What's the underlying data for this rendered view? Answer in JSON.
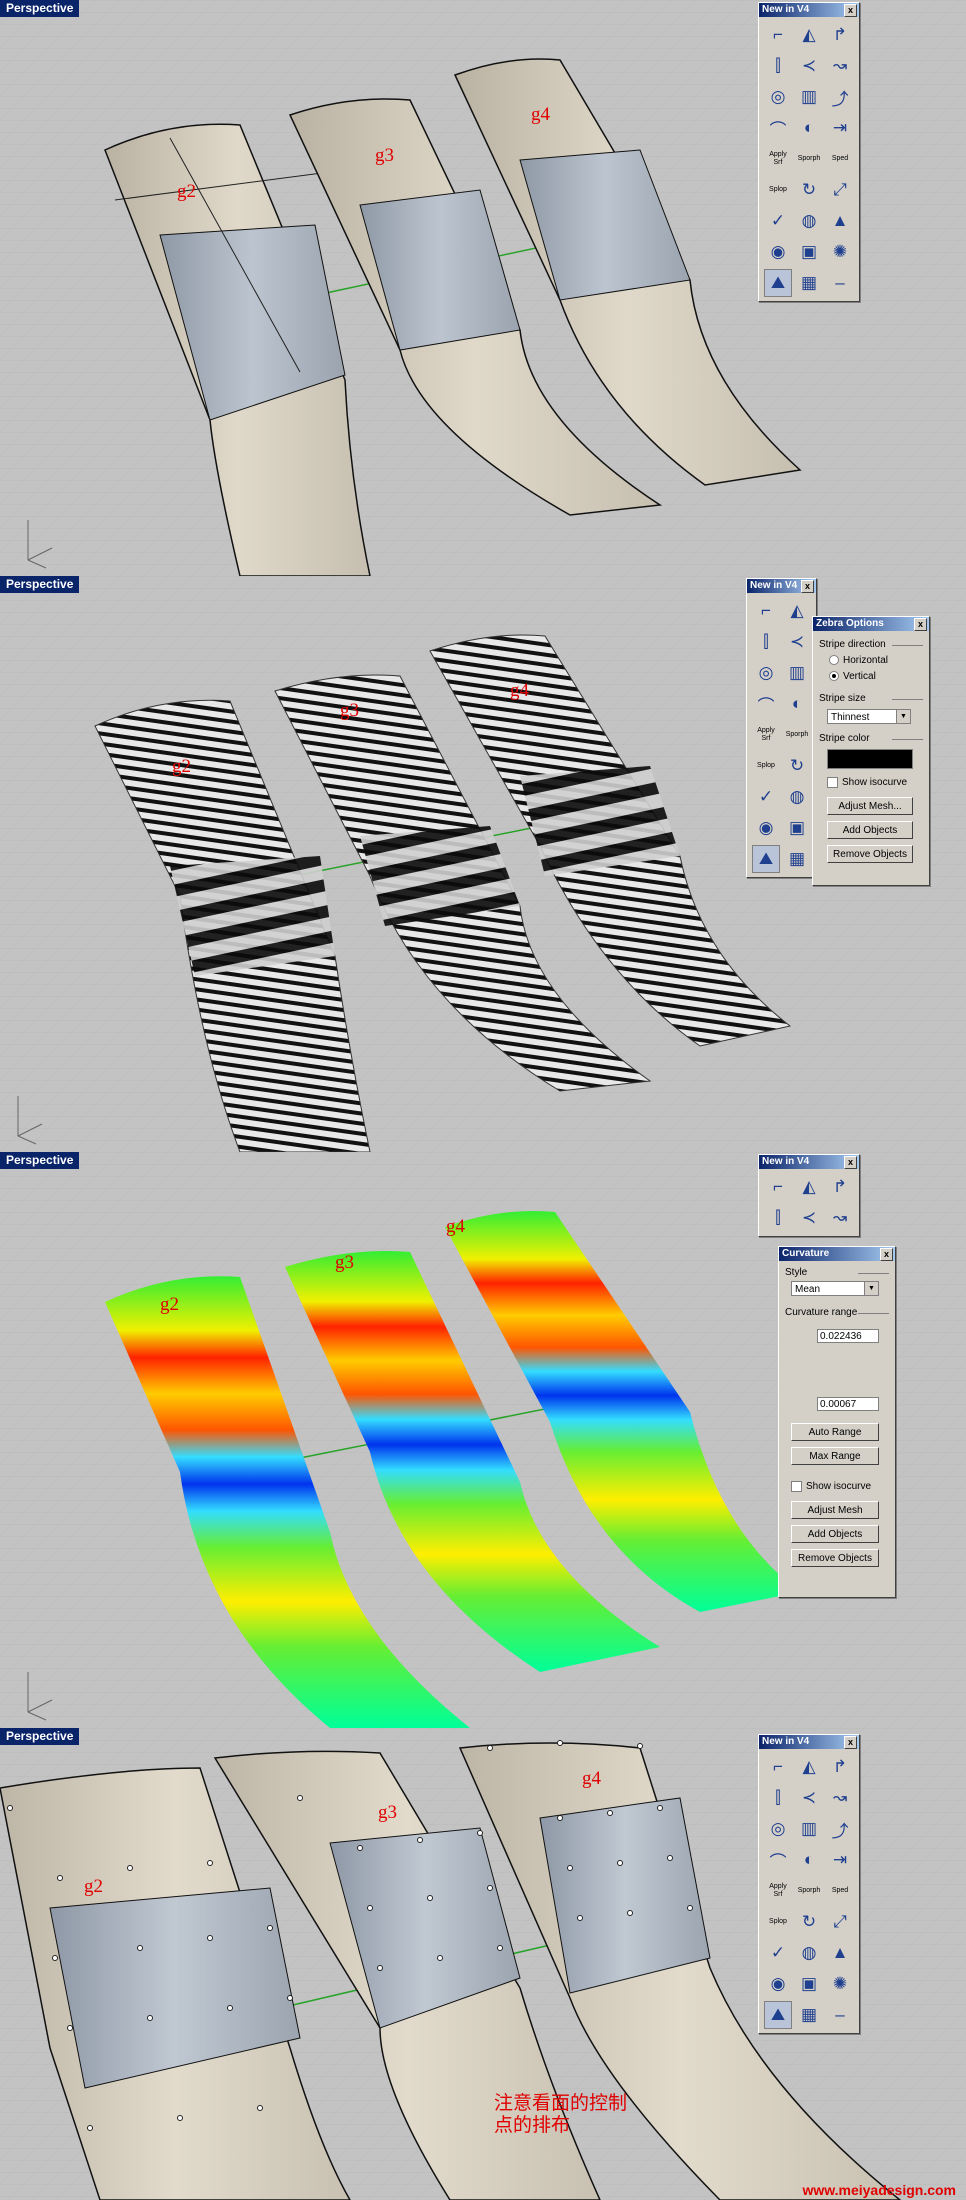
{
  "viewports": [
    {
      "title": "Perspective",
      "labels": [
        "g2",
        "g3",
        "g4"
      ]
    },
    {
      "title": "Perspective",
      "labels": [
        "g2",
        "g3",
        "g4"
      ]
    },
    {
      "title": "Perspective",
      "labels": [
        "g2",
        "g3",
        "g4"
      ]
    },
    {
      "title": "Perspective",
      "labels": [
        "g2",
        "g3",
        "g4"
      ]
    }
  ],
  "toolbar": {
    "title": "New in V4",
    "close": "x",
    "buttons": [
      {
        "icon": "fillet-edge-icon"
      },
      {
        "icon": "extend-surface-icon"
      },
      {
        "icon": "blend-edge-icon"
      },
      {
        "icon": "split-edge-icon"
      },
      {
        "icon": "merge-edge-icon"
      },
      {
        "icon": "flow-icon"
      },
      {
        "icon": "twist-icon"
      },
      {
        "icon": "taper-icon"
      },
      {
        "icon": "bend-icon"
      },
      {
        "icon": "stretch-icon"
      },
      {
        "icon": "maelstrom-icon"
      },
      {
        "icon": "cage-icon"
      },
      {
        "icon": "apply-srf-icon",
        "label": "Apply Srf"
      },
      {
        "icon": "sporph-icon",
        "label": "Sporph"
      },
      {
        "icon": "sped-icon",
        "label": "Sped"
      },
      {
        "icon": "splop-icon",
        "label": "Splop"
      },
      {
        "icon": "rotate-icon"
      },
      {
        "icon": "scale-icon"
      },
      {
        "icon": "check-icon"
      },
      {
        "icon": "sphere-icon"
      },
      {
        "icon": "cone-icon"
      },
      {
        "icon": "torus-icon"
      },
      {
        "icon": "box-icon"
      },
      {
        "icon": "helix-icon"
      },
      {
        "icon": "environment-map-icon"
      },
      {
        "icon": "zebra-grid-icon"
      },
      {
        "icon": "dash-icon"
      }
    ]
  },
  "zebra_options": {
    "title": "Zebra Options",
    "close": "x",
    "stripe_direction_label": "Stripe direction",
    "horizontal_label": "Horizontal",
    "vertical_label": "Vertical",
    "stripe_size_label": "Stripe size",
    "stripe_size_value": "Thinnest",
    "stripe_color_label": "Stripe color",
    "stripe_color": "#000000",
    "show_isocurve_label": "Show isocurve",
    "adjust_mesh_label": "Adjust Mesh...",
    "add_objects_label": "Add Objects",
    "remove_objects_label": "Remove Objects"
  },
  "curvature": {
    "title": "Curvature",
    "close": "x",
    "style_label": "Style",
    "style_value": "Mean",
    "range_label": "Curvature range",
    "max_value": "0.022436",
    "min_value": "0.00067",
    "auto_range_label": "Auto Range",
    "max_range_label": "Max Range",
    "show_isocurve_label": "Show isocurve",
    "adjust_mesh_label": "Adjust Mesh",
    "add_objects_label": "Add Objects",
    "remove_objects_label": "Remove Objects"
  },
  "annotation": {
    "line1": "注意看面的控制",
    "line2": "点的排布"
  },
  "watermark": "www.meiyadesign.com",
  "colors": {
    "viewport_bg": "#c3c3c3",
    "title_bg": "#0a246a",
    "surface": "#d9d2c2",
    "selected": "#a9b3bf",
    "label_red": "#e00000"
  }
}
